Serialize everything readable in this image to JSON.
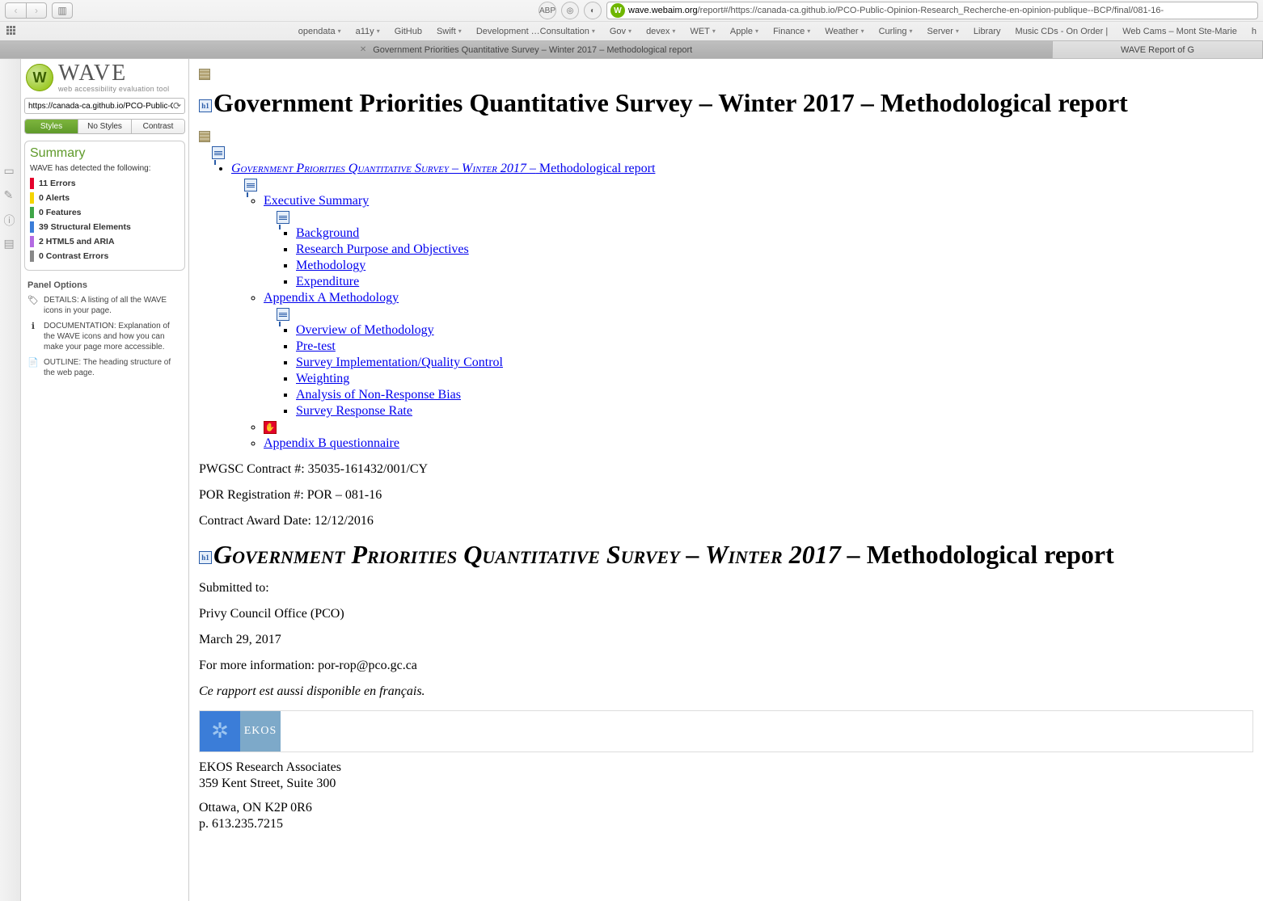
{
  "browser": {
    "url_host": "wave.webaim.org",
    "url_path": "/report#/https://canada-ca.github.io/PCO-Public-Opinion-Research_Recherche-en-opinion-publique--BCP/final/081-16-",
    "bookmarks": [
      "opendata",
      "a11y",
      "GitHub",
      "Swift",
      "Development …Consultation",
      "Gov",
      "devex",
      "WET",
      "Apple",
      "Finance",
      "Weather",
      "Curling",
      "Server",
      "Library",
      "Music CDs - On Order |",
      "Web Cams – Mont Ste-Marie",
      "h"
    ],
    "tabs": {
      "active": "Government Priorities Quantitative Survey – Winter 2017 – Methodological report",
      "inactive": "WAVE Report of G"
    }
  },
  "sidebar": {
    "brand": "WAVE",
    "tagline": "web accessibility evaluation tool",
    "url": "https://canada-ca.github.io/PCO-Public-O",
    "tabs": [
      "Styles",
      "No Styles",
      "Contrast"
    ],
    "summary_title": "Summary",
    "summary_sub": "WAVE has detected the following:",
    "rows": [
      {
        "count": "11",
        "label": "Errors",
        "cls": "red"
      },
      {
        "count": "0",
        "label": "Alerts",
        "cls": "yellow"
      },
      {
        "count": "0",
        "label": "Features",
        "cls": "green"
      },
      {
        "count": "39",
        "label": "Structural Elements",
        "cls": "blue"
      },
      {
        "count": "2",
        "label": "HTML5 and ARIA",
        "cls": "purple"
      },
      {
        "count": "0",
        "label": "Contrast Errors",
        "cls": "gray"
      }
    ],
    "panel_title": "Panel Options",
    "opts": [
      {
        "icon": "🏷",
        "title": "DETAILS:",
        "text": " A listing of all the WAVE icons in your page."
      },
      {
        "icon": "ℹ",
        "title": "DOCUMENTATION:",
        "text": " Explanation of the WAVE icons and how you can make your page more accessible."
      },
      {
        "icon": "📄",
        "title": "OUTLINE:",
        "text": " The heading structure of the web page."
      }
    ]
  },
  "doc": {
    "h1": "Government Priorities Quantitative Survey – Winter 2017 – Methodological report",
    "toc_title_sc": "Government Priorities Quantitative Survey – Winter 2017 –",
    "toc_title_rest": " Methodological report",
    "exec": "Executive Summary",
    "exec_items": [
      "Background",
      "Research Purpose and Objectives",
      "Methodology",
      "Expenditure"
    ],
    "appA": "Appendix A Methodology",
    "appA_items": [
      "Overview of Methodology",
      "Pre-test",
      "Survey Implementation/Quality Control",
      "Weighting",
      "Analysis of Non-Response Bias",
      "Survey Response Rate"
    ],
    "appB": "Appendix B questionnaire",
    "meta": {
      "contract": "PWGSC Contract #: 35035-161432/001/CY",
      "por": "POR Registration #: POR – 081-16",
      "award": "Contract Award Date: 12/12/2016",
      "submitted": "Submitted to:",
      "pco": "Privy Council Office (PCO)",
      "date": "March 29, 2017",
      "info": "For more information: por-rop@pco.gc.ca",
      "fr": "Ce rapport est aussi disponible en français.",
      "ekos": "EKOS",
      "company": "EKOS Research Associates",
      "addr": "359 Kent Street, Suite 300",
      "city": "Ottawa, ON K2P 0R6",
      "phone": "p. 613.235.7215"
    },
    "h1b_sc": "Government Priorities Quantitative Survey – Winter 2017 –",
    "h1b_rest": " Methodological report"
  }
}
